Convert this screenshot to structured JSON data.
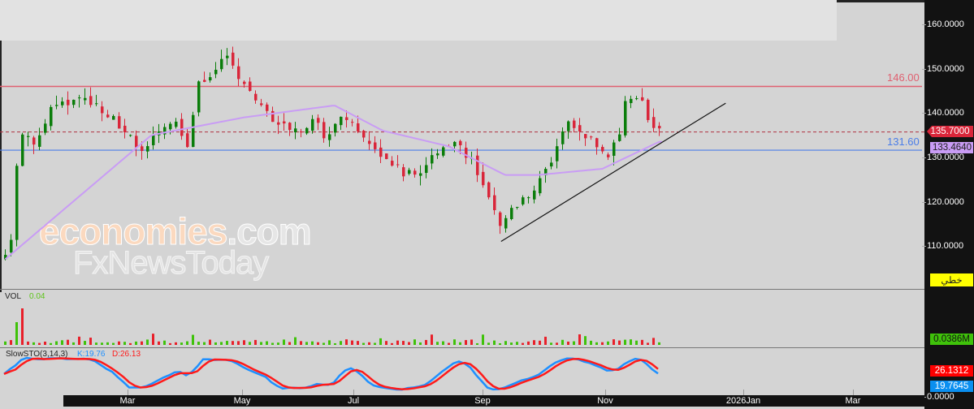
{
  "price_axis": {
    "ticks": [
      "160.0000",
      "150.0000",
      "140.0000",
      "130.0000",
      "120.0000",
      "110.0000"
    ],
    "tick_values": [
      160,
      150,
      140,
      130,
      120,
      110
    ],
    "last_price": "135.7000",
    "ma_value": "133.4640",
    "mode_label": "خطي"
  },
  "lines": {
    "resistance": {
      "label": "146.00",
      "value": 146,
      "color": "#e06070"
    },
    "support": {
      "label": "131.60",
      "value": 131.6,
      "color": "#4a7de8"
    }
  },
  "volume": {
    "title": "VOL",
    "value": "0.04",
    "last": "0.0386M"
  },
  "stochastic": {
    "title": "SlowSTO(3,14,3)",
    "k_label": "K:19.76",
    "d_label": "D:26.13",
    "d_value": "26.1312",
    "k_value": "19.7645",
    "bottom_tick": "0.0000"
  },
  "x_axis": {
    "labels": [
      "Mar",
      "May",
      "Jul",
      "Sep",
      "Nov",
      "2026Jan",
      "Mar"
    ]
  },
  "watermark": {
    "line1": "economies",
    "line1b": ".com",
    "line2": "FxNewsToday"
  },
  "colors": {
    "up": "#0a7d0a",
    "down": "#d9263a",
    "ma": "#c99cf5",
    "k": "#1e90ff",
    "d": "#ff1a1a"
  },
  "chart_data": {
    "type": "candlestick",
    "ylim": [
      103,
      163
    ],
    "bars": 116,
    "close_waypoints": [
      [
        0,
        108
      ],
      [
        1.4,
        114
      ],
      [
        2,
        129
      ],
      [
        3,
        135
      ],
      [
        5,
        132.5
      ],
      [
        8,
        141
      ],
      [
        14,
        143.5
      ],
      [
        18,
        140
      ],
      [
        21,
        136
      ],
      [
        24.3,
        130
      ],
      [
        26.4,
        135
      ],
      [
        30,
        138
      ],
      [
        32,
        132.5
      ],
      [
        34,
        147
      ],
      [
        36.4,
        149
      ],
      [
        38.6,
        152.7
      ],
      [
        40.7,
        149
      ],
      [
        45,
        141.7
      ],
      [
        48.6,
        137
      ],
      [
        52,
        136
      ],
      [
        54,
        139
      ],
      [
        56.4,
        134
      ],
      [
        58.6,
        139
      ],
      [
        62,
        136
      ],
      [
        66.4,
        130.7
      ],
      [
        70.7,
        126
      ],
      [
        73.6,
        127
      ],
      [
        76.4,
        132.5
      ],
      [
        79.3,
        134
      ],
      [
        82,
        129
      ],
      [
        85,
        120.6
      ],
      [
        87,
        114
      ],
      [
        89,
        118
      ],
      [
        93.6,
        124
      ],
      [
        96.4,
        130
      ],
      [
        98.6,
        138
      ],
      [
        102,
        135
      ],
      [
        105.7,
        130
      ],
      [
        108,
        136
      ],
      [
        109.3,
        143.5
      ],
      [
        112,
        143.5
      ],
      [
        113.6,
        137
      ],
      [
        115,
        135.7
      ]
    ],
    "ma_waypoints": [
      [
        0,
        107
      ],
      [
        25.7,
        135
      ],
      [
        42,
        139
      ],
      [
        57.9,
        141.7
      ],
      [
        66.4,
        136
      ],
      [
        77.9,
        132.5
      ],
      [
        87.9,
        126
      ],
      [
        93.6,
        126
      ],
      [
        105,
        127.4
      ],
      [
        115,
        133.5
      ]
    ],
    "trendline": [
      [
        87.4,
        111
      ],
      [
        126.9,
        142.2
      ]
    ]
  }
}
